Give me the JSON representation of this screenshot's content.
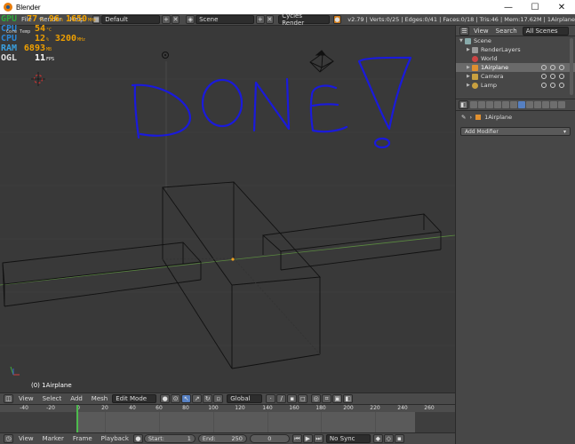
{
  "window": {
    "title": "Blender",
    "min": "—",
    "max": "☐",
    "close": "✕"
  },
  "infobar": {
    "menus": [
      "File",
      "Render",
      "Help"
    ],
    "layout": "Default",
    "scene": "Scene",
    "engine": "Cycles Render",
    "stats": "v2.79 | Verts:0/25 | Edges:0/41 | Faces:0/18 | Tris:46 | Mem:17.62M | 1Airplane"
  },
  "hud": {
    "gpu": {
      "label": "GPU",
      "value": "77",
      "unit": "°C",
      "usage": "96",
      "usage_unit": "%",
      "clock": "1650",
      "clock_unit": "MHz"
    },
    "cpu1": {
      "label": "CPU",
      "value": "54",
      "unit": "°C",
      "sub": "Core Temp"
    },
    "cpu2": {
      "label": "CPU",
      "value": "12",
      "unit": "%",
      "clock": "3200",
      "clock_unit": "MHz"
    },
    "ram": {
      "label": "RAM",
      "value": "6893",
      "unit": "MB"
    },
    "ogl": {
      "label": "OGL",
      "value": "11",
      "unit": "FPS"
    }
  },
  "viewport": {
    "annotation": "DONE!",
    "object_label": "(0) 1Airplane"
  },
  "viewport_header": {
    "menus": [
      "View",
      "Select",
      "Add",
      "Mesh"
    ],
    "mode": "Edit Mode",
    "orientation": "Global"
  },
  "timeline": {
    "ticks": [
      "-40",
      "-20",
      "0",
      "20",
      "40",
      "60",
      "80",
      "100",
      "120",
      "140",
      "160",
      "180",
      "200",
      "220",
      "240",
      "260"
    ]
  },
  "timeline_header": {
    "menus": [
      "View",
      "Marker",
      "Frame",
      "Playback"
    ],
    "start_label": "Start:",
    "start_value": "1",
    "end_label": "End:",
    "end_value": "250",
    "current": "0",
    "sync": "No Sync"
  },
  "outliner": {
    "menus": [
      "View",
      "Search"
    ],
    "filter": "All Scenes",
    "items": [
      {
        "label": "Scene",
        "indent": 0
      },
      {
        "label": "RenderLayers",
        "indent": 1
      },
      {
        "label": "World",
        "indent": 1
      },
      {
        "label": "1Airplane",
        "indent": 1,
        "selected": true
      },
      {
        "label": "Camera",
        "indent": 1
      },
      {
        "label": "Lamp",
        "indent": 1
      }
    ]
  },
  "properties": {
    "object": "1Airplane",
    "add_modifier": "Add Modifier"
  },
  "colors": {
    "accent": "#5680c2",
    "hud_value": "#f0a000",
    "annotation": "#1a1adb",
    "timeline_cursor": "#4dbb4d"
  }
}
